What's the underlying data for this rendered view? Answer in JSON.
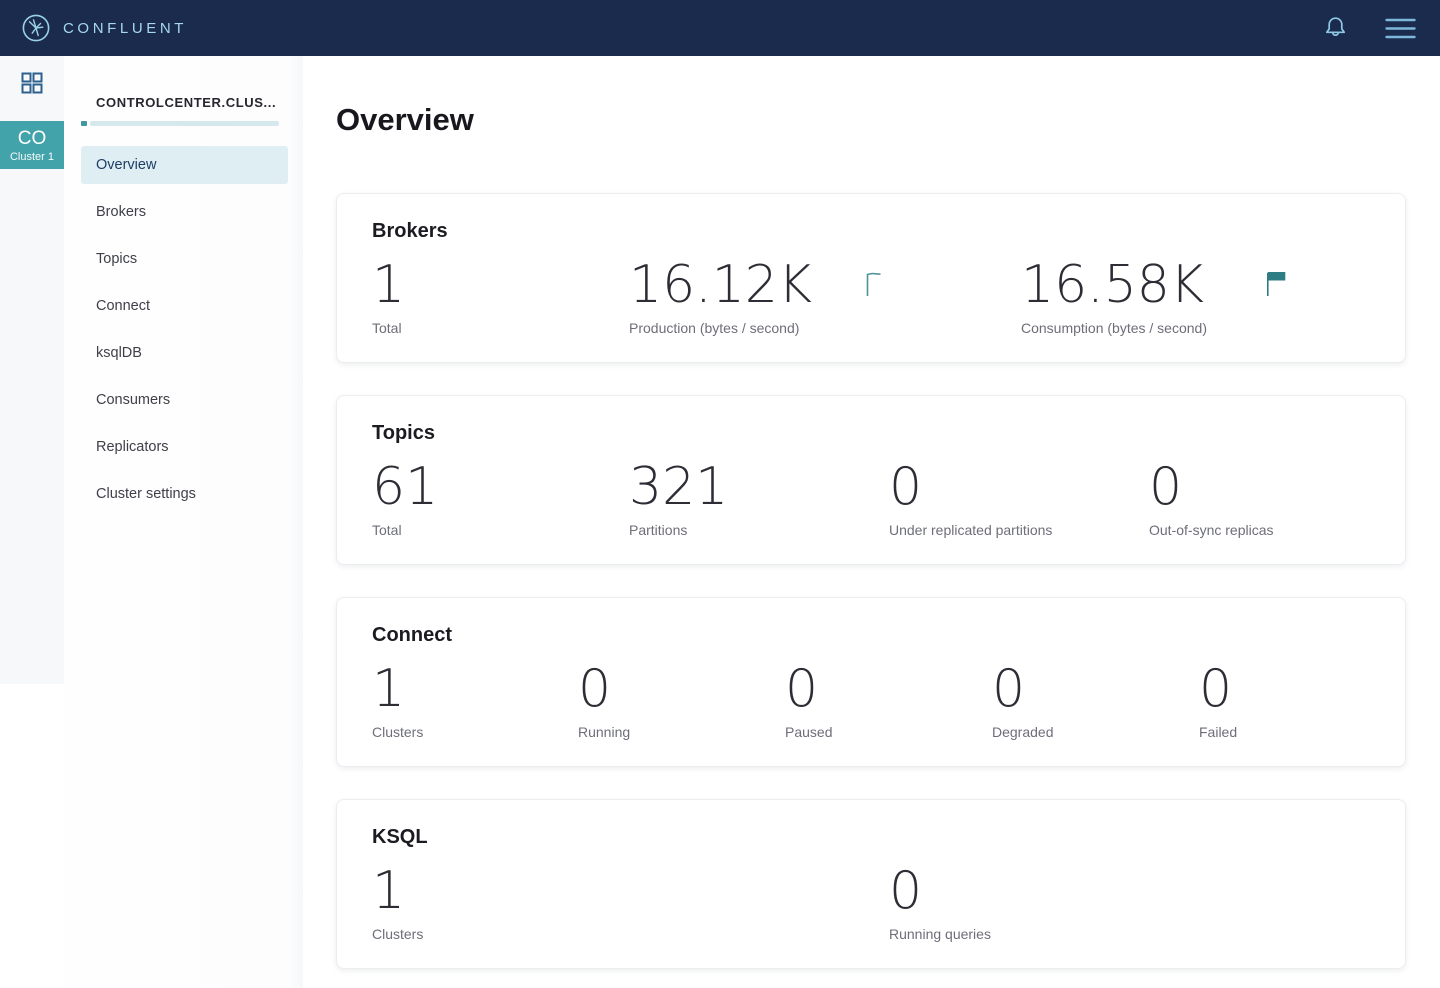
{
  "navbar": {
    "brand": "CONFLUENT",
    "icons": {
      "notifications": "bell-icon",
      "menu": "hamburger-icon"
    }
  },
  "rail": {
    "apps_icon": "grid-icon",
    "cluster_badge": {
      "initials": "CO",
      "name": "Cluster 1"
    }
  },
  "sidebar": {
    "header": "CONTROLCENTER.CLUS...",
    "items": [
      {
        "label": "Overview",
        "selected": true
      },
      {
        "label": "Brokers",
        "selected": false
      },
      {
        "label": "Topics",
        "selected": false
      },
      {
        "label": "Connect",
        "selected": false
      },
      {
        "label": "ksqlDB",
        "selected": false
      },
      {
        "label": "Consumers",
        "selected": false
      },
      {
        "label": "Replicators",
        "selected": false
      },
      {
        "label": "Cluster settings",
        "selected": false
      }
    ]
  },
  "main": {
    "title": "Overview",
    "cards": [
      {
        "title": "Brokers",
        "stats": [
          {
            "value": "1",
            "label": "Total"
          },
          {
            "value": "16.12K",
            "label": "Production (bytes / second)"
          },
          {
            "value": "16.58K",
            "label": "Consumption (bytes / second)"
          }
        ],
        "sparklines": [
          "production-sparkline",
          "consumption-sparkline"
        ]
      },
      {
        "title": "Topics",
        "stats": [
          {
            "value": "61",
            "label": "Total"
          },
          {
            "value": "321",
            "label": "Partitions"
          },
          {
            "value": "0",
            "label": "Under replicated partitions"
          },
          {
            "value": "0",
            "label": "Out-of-sync replicas"
          }
        ]
      },
      {
        "title": "Connect",
        "stats": [
          {
            "value": "1",
            "label": "Clusters"
          },
          {
            "value": "0",
            "label": "Running"
          },
          {
            "value": "0",
            "label": "Paused"
          },
          {
            "value": "0",
            "label": "Degraded"
          },
          {
            "value": "0",
            "label": "Failed"
          }
        ]
      },
      {
        "title": "KSQL",
        "stats": [
          {
            "value": "1",
            "label": "Clusters"
          },
          {
            "value": "0",
            "label": "Running queries"
          }
        ]
      }
    ]
  },
  "colors": {
    "navbar_bg": "#1a2b4d",
    "brand_text": "#a8d8ee",
    "cluster_badge_bg": "#43a3ab",
    "selected_item_bg": "#dfeef3",
    "selected_item_text": "#1e3e66",
    "sparkline_stroke": "#4d919c",
    "sparkline_fill": "#2e7d85",
    "health_indicator": "#3e98a2",
    "health_track": "#d5e9ed"
  }
}
